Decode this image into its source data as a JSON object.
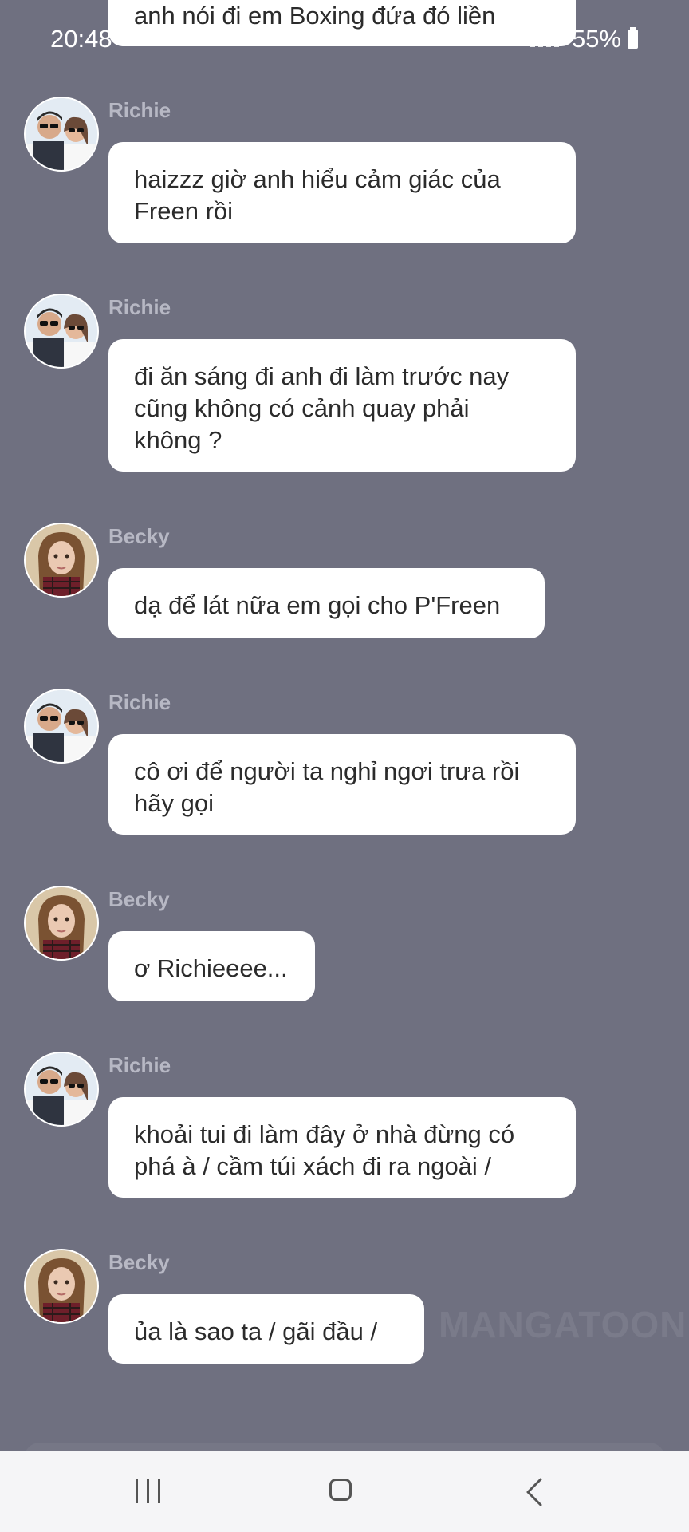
{
  "status_bar": {
    "time": "20:48",
    "battery": "55%"
  },
  "top_message": {
    "text": "anh nói đi em Boxing đứa đó liền"
  },
  "messages": [
    {
      "sender": "Richie",
      "text": "haizzz giờ anh hiểu cảm giác của\nFreen rồi"
    },
    {
      "sender": "Richie",
      "text": "đi ăn sáng đi anh đi làm trước nay\ncũng không có cảnh quay phải\nkhông ?"
    },
    {
      "sender": "Becky",
      "text": "dạ để lát nữa em gọi cho P'Freen"
    },
    {
      "sender": "Richie",
      "text": "cô ơi để người ta nghỉ ngơi trưa rồi\nhãy gọi"
    },
    {
      "sender": "Becky",
      "text": "ơ Richieeee..."
    },
    {
      "sender": "Richie",
      "text": "khoải tui đi làm đây ở nhà đừng có\nphá à / cầm túi xách đi ra ngoài /"
    },
    {
      "sender": "Becky",
      "text": "ủa là sao ta / gãi đầu /"
    }
  ],
  "watermark": "MANGATOON",
  "colors": {
    "background": "#6f7080",
    "bubble": "#ffffff",
    "sender_name": "#b7b8c4",
    "nav_bar": "#f5f5f7"
  },
  "icons": {
    "nav_recents": "recents-icon",
    "nav_home": "home-icon",
    "nav_back": "back-icon"
  }
}
